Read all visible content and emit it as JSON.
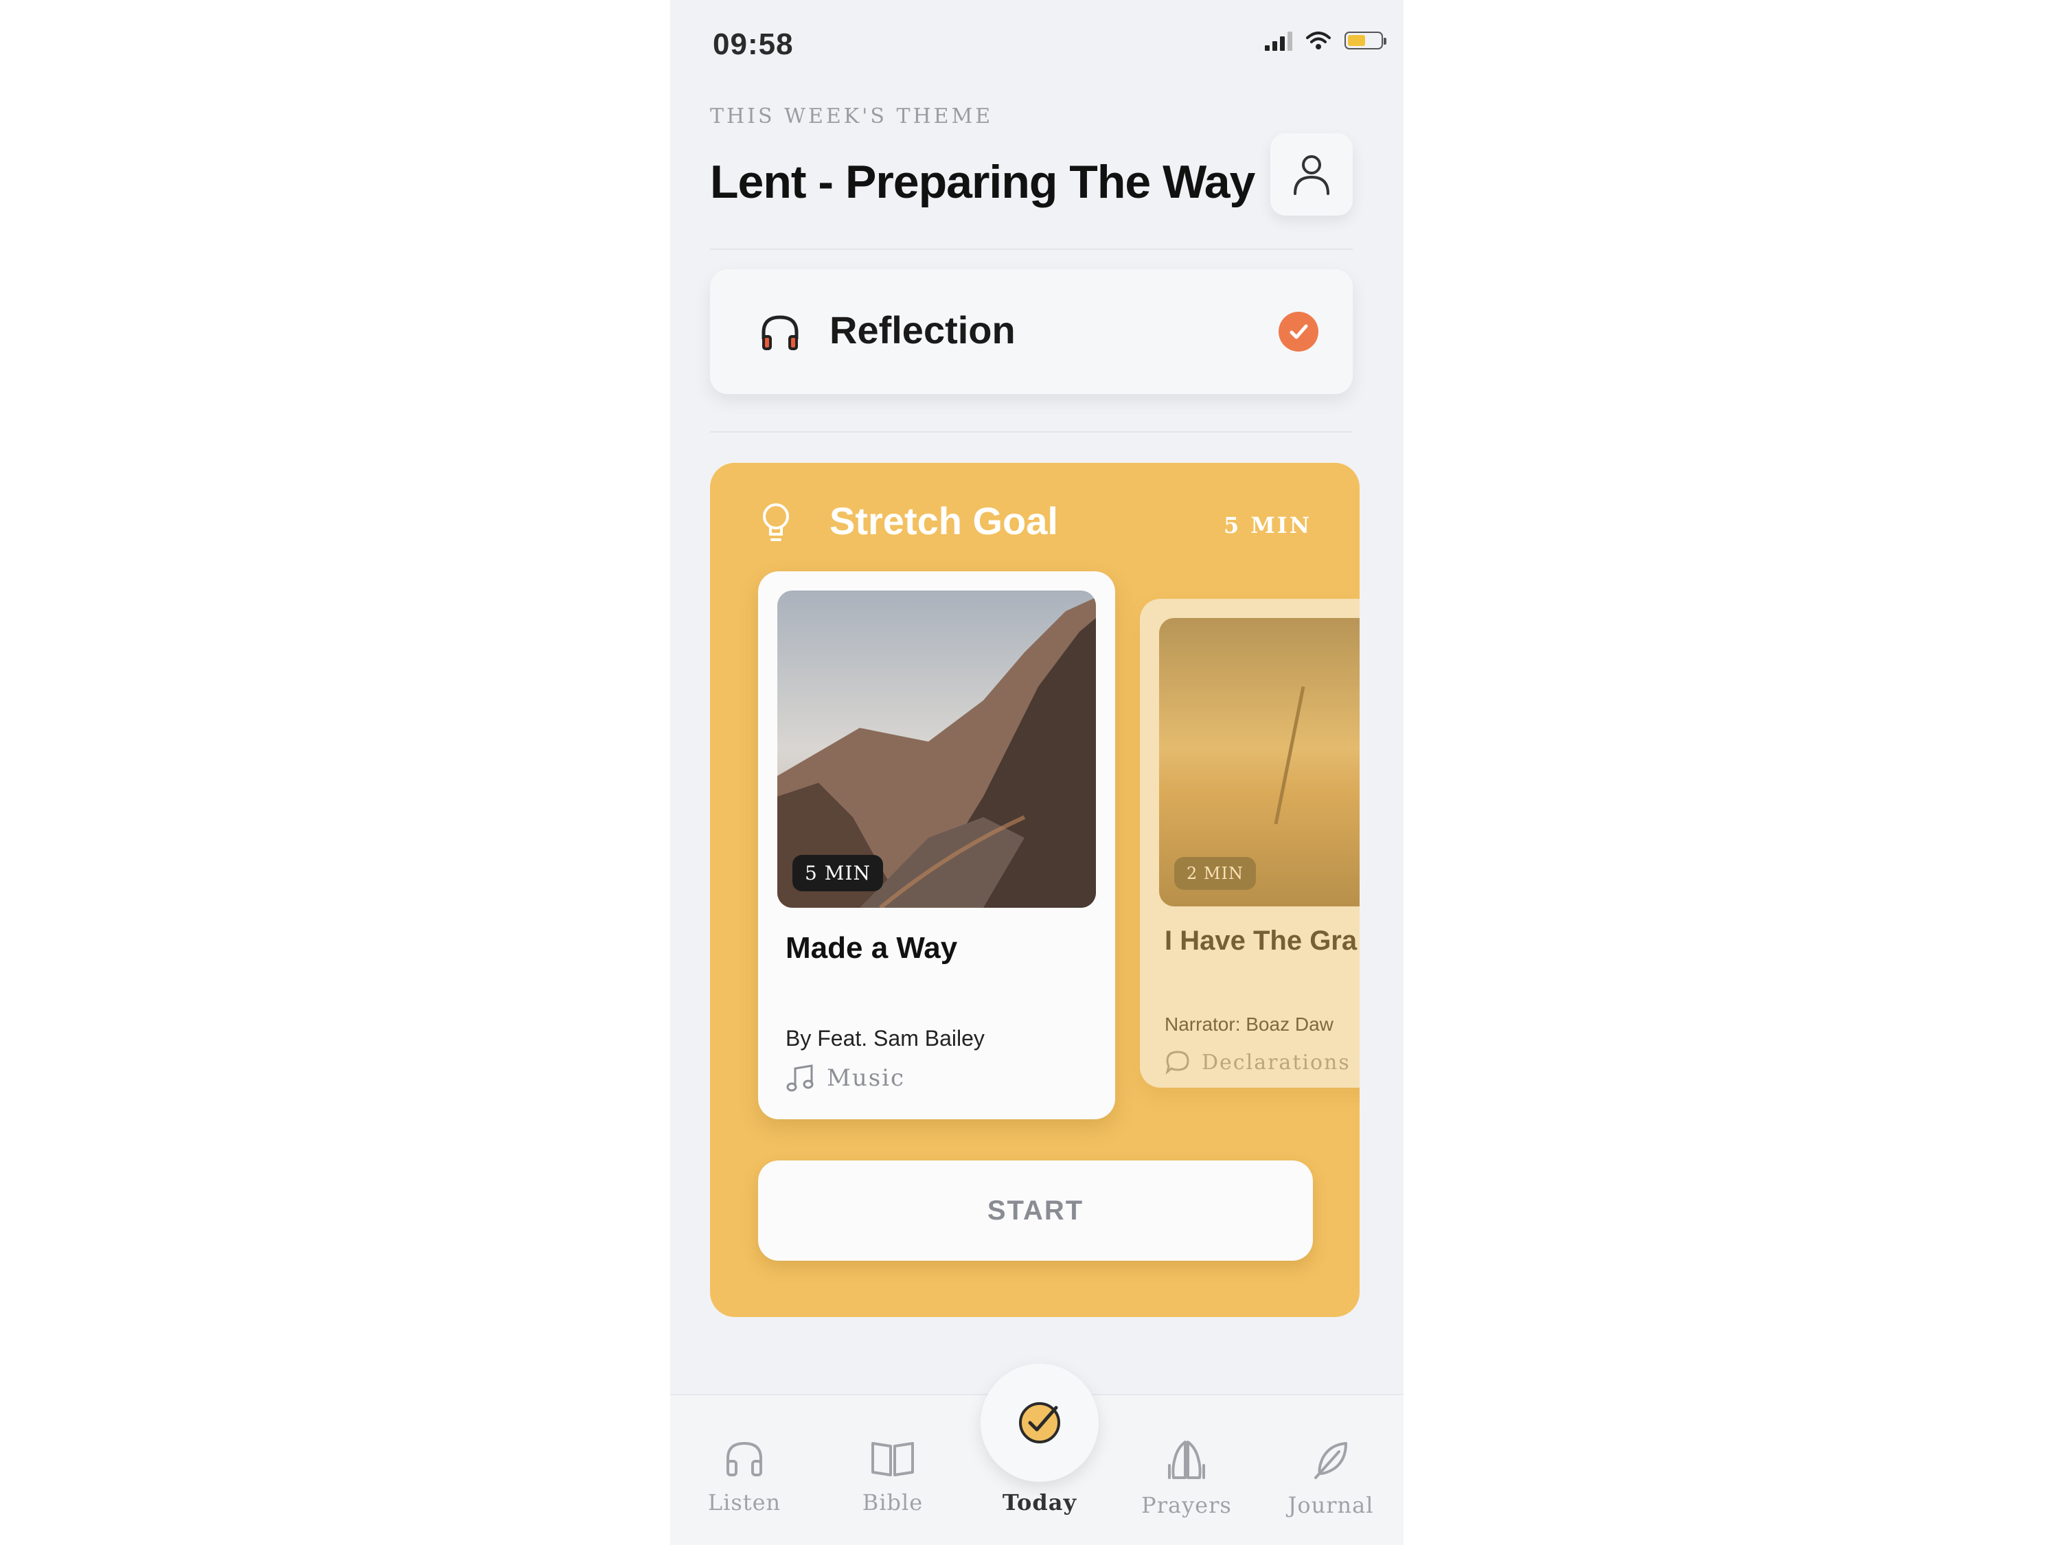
{
  "status_bar": {
    "time": "09:58"
  },
  "header": {
    "theme_label": "THIS WEEK'S THEME",
    "theme_title": "Lent - Preparing The Way"
  },
  "reflection": {
    "label": "Reflection",
    "completed": true
  },
  "stretch_goal": {
    "title": "Stretch Goal",
    "duration": "5 MIN",
    "cards": [
      {
        "duration": "5 MIN",
        "title": "Made a Way",
        "author": "By Feat. Sam Bailey",
        "category": "Music"
      },
      {
        "duration": "2 MIN",
        "title": "I Have The Gra",
        "author": "Narrator: Boaz Daw",
        "category": "Declarations"
      }
    ],
    "start_label": "START"
  },
  "tabs": [
    {
      "label": "Listen",
      "icon": "headphones-icon"
    },
    {
      "label": "Bible",
      "icon": "book-icon"
    },
    {
      "label": "Today",
      "icon": "check-circle-icon"
    },
    {
      "label": "Prayers",
      "icon": "praying-hands-icon"
    },
    {
      "label": "Journal",
      "icon": "feather-icon"
    }
  ],
  "colors": {
    "accent": "#f2c060",
    "check": "#ee7a4c",
    "background": "#f1f2f5"
  }
}
